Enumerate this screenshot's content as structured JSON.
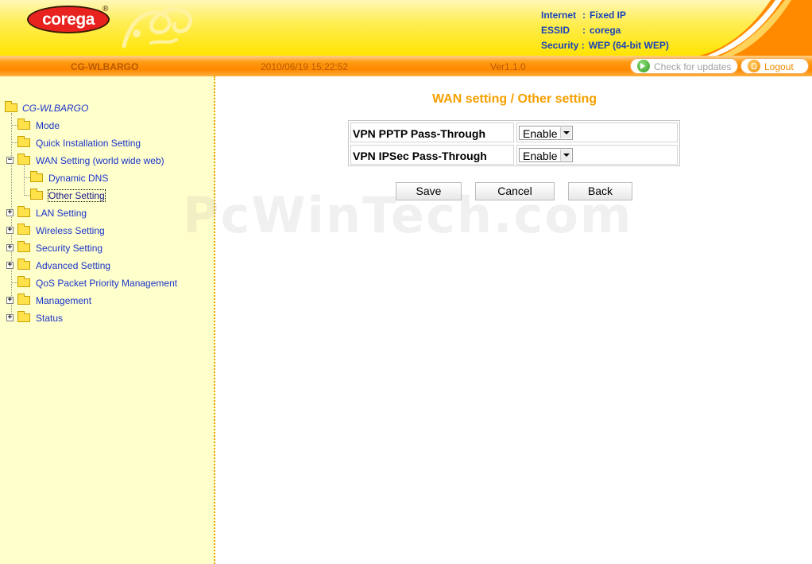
{
  "brand": {
    "logo_text": "corega",
    "logo_mark": "®"
  },
  "status": {
    "internet_label": "Internet",
    "internet_value": "Fixed IP",
    "essid_label": "ESSID",
    "essid_value": "corega",
    "security_label": "Security",
    "security_value": "WEP (64-bit WEP)",
    "separator": ":"
  },
  "topbar": {
    "model": "CG-WLBARGO",
    "datetime": "2010/06/19 15:22:52",
    "version": "Ver1.1.0",
    "check_updates": "Check for updates",
    "logout": "Logout"
  },
  "sidebar": {
    "root": "CG-WLBARGO",
    "items": [
      {
        "label": "Mode"
      },
      {
        "label": "Quick Installation Setting"
      },
      {
        "label": "WAN Setting (world wide web)",
        "expander": "−"
      },
      {
        "label": "Dynamic DNS"
      },
      {
        "label": "Other Setting"
      },
      {
        "label": "LAN Setting",
        "expander": "+"
      },
      {
        "label": "Wireless Setting",
        "expander": "+"
      },
      {
        "label": "Security Setting",
        "expander": "+"
      },
      {
        "label": "Advanced Setting",
        "expander": "+"
      },
      {
        "label": "QoS Packet Priority Management"
      },
      {
        "label": "Management",
        "expander": "+"
      },
      {
        "label": "Status",
        "expander": "+"
      }
    ]
  },
  "main": {
    "title": "WAN setting / Other setting",
    "rows": [
      {
        "label": "VPN PPTP Pass-Through",
        "value": "Enable"
      },
      {
        "label": "VPN IPSec Pass-Through",
        "value": "Enable"
      }
    ],
    "buttons": {
      "save": "Save",
      "cancel": "Cancel",
      "back": "Back"
    }
  },
  "watermark": "PcWinTech.com",
  "colors": {
    "accent_orange": "#ff8800",
    "title_orange": "#f5a000",
    "link_blue": "#1a34c8",
    "sidebar_bg": "#ffffcc"
  },
  "icons": {
    "update": "update-arrow-icon",
    "logout": "logout-lock-icon",
    "folder": "folder-icon"
  }
}
